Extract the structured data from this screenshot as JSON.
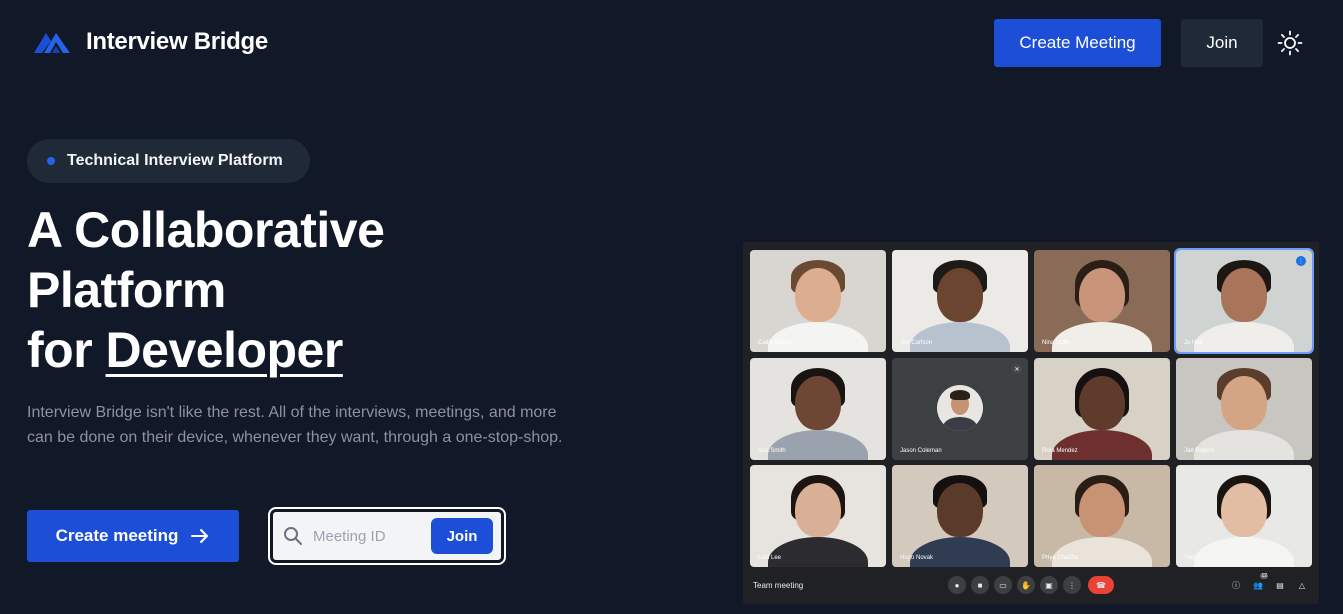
{
  "nav": {
    "brand": "Interview Bridge",
    "create_meeting_label": "Create Meeting",
    "join_label": "Join",
    "theme_icon": "sun-icon",
    "brand_icon": "mountain-logo-icon"
  },
  "hero": {
    "pill_label": "Technical Interview Platform",
    "headline_line1": "A Collaborative",
    "headline_line2": "Platform",
    "headline_line3_prefix": "for ",
    "headline_line3_emphasis": "Developer",
    "description": "Interview Bridge isn't like the rest. All of the interviews, meetings, and more can be done on their device, whenever they want, through a one-stop-shop.",
    "create_meeting_label": "Create meeting",
    "meeting_id_placeholder": "Meeting ID",
    "join_label": "Join"
  },
  "meeting": {
    "title": "Team meeting",
    "participants_count": "12",
    "participants": [
      {
        "name": "Callin Garner"
      },
      {
        "name": "Joe Carlson"
      },
      {
        "name": "Nina Duffy"
      },
      {
        "name": "Jo Hall"
      },
      {
        "name": "Ana Smith"
      },
      {
        "name": "Jason Coleman"
      },
      {
        "name": "Rota Mendez"
      },
      {
        "name": "Jad Rogers"
      },
      {
        "name": "Lani Lee"
      },
      {
        "name": "Hugo Novak"
      },
      {
        "name": "Priya Chacha"
      },
      {
        "name": "You"
      }
    ]
  },
  "colors": {
    "background": "#111827",
    "accent": "#1d4ed8",
    "secondary_button": "#1f2937",
    "muted_text": "#8b93a3",
    "end_call": "#ea4335"
  }
}
